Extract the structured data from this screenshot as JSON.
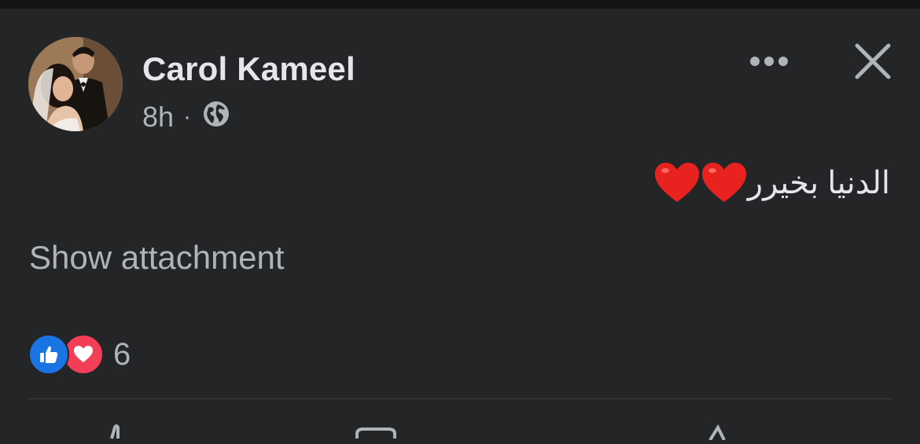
{
  "post": {
    "author": "Carol Kameel",
    "time": "8h",
    "separator": "·",
    "privacy_icon": "globe-icon",
    "text": "الدنيا بخيرر",
    "text_emoji": "❤️❤️",
    "show_attachment_label": "Show attachment"
  },
  "reactions": {
    "types": [
      "like",
      "love"
    ],
    "count": "6"
  },
  "actions": {
    "icons": [
      "like-icon",
      "comment-icon",
      "share-icon"
    ]
  },
  "colors": {
    "background": "#242527",
    "text_primary": "#e4e6eb",
    "text_secondary": "#b0b3b8",
    "like_blue": "#1b74e4",
    "love_red": "#f33e58"
  }
}
